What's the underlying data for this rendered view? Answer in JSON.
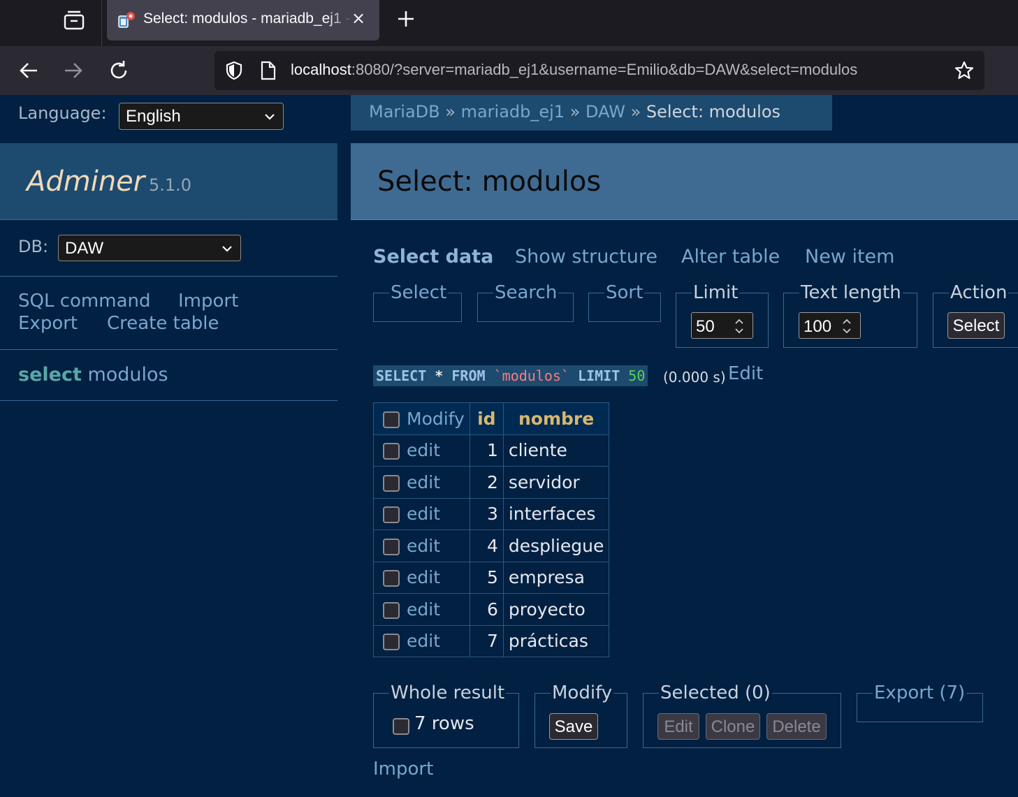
{
  "browser": {
    "tab_title": "Select: modulos - mariadb_ej1 - Adminer",
    "tab_close": "×",
    "url_host": "localhost",
    "url_rest": ":8080/?server=mariadb_ej1&username=Emilio&db=DAW&select=modulos",
    "icons": [
      "tab-overview-icon",
      "adminer-favicon-icon",
      "close-icon",
      "plus-icon",
      "back-arrow-icon",
      "forward-arrow-icon",
      "reload-icon",
      "shield-icon",
      "page-icon",
      "star-icon"
    ]
  },
  "language": {
    "label": "Language:",
    "value": "English"
  },
  "breadcrumb": {
    "items": [
      "MariaDB",
      "mariadb_ej1",
      "DAW"
    ],
    "separator": "»",
    "current": "Select: modulos"
  },
  "sidebar": {
    "brand": "Adminer",
    "version": "5.1.0",
    "db_label": "DB:",
    "db_value": "DAW",
    "links": {
      "sql": "SQL command",
      "import": "Import",
      "export": "Export",
      "create": "Create table"
    },
    "table_select_kw": "select",
    "table_name": "modulos"
  },
  "main": {
    "title": "Select: modulos",
    "menu": {
      "select_data": "Select data",
      "show_structure": "Show structure",
      "alter_table": "Alter table",
      "new_item": "New item"
    },
    "form": {
      "select": "Select",
      "search": "Search",
      "sort": "Sort",
      "limit": "Limit",
      "limit_value": "50",
      "text_length": "Text length",
      "text_length_value": "100",
      "action": "Action",
      "action_button": "Select"
    },
    "query": {
      "select": "SELECT",
      "star": "*",
      "from": "FROM",
      "table": "`modulos`",
      "limit": "LIMIT",
      "limit_value": "50",
      "timing": "(0.000 s)",
      "edit": "Edit"
    },
    "table": {
      "headers": {
        "modify": "Modify",
        "id": "id",
        "nombre": "nombre"
      },
      "edit_label": "edit",
      "rows": [
        {
          "id": "1",
          "nombre": "cliente"
        },
        {
          "id": "2",
          "nombre": "servidor"
        },
        {
          "id": "3",
          "nombre": "interfaces"
        },
        {
          "id": "4",
          "nombre": "despliegue"
        },
        {
          "id": "5",
          "nombre": "empresa"
        },
        {
          "id": "6",
          "nombre": "proyecto"
        },
        {
          "id": "7",
          "nombre": "prácticas"
        }
      ]
    },
    "bottom": {
      "whole_result": "Whole result",
      "rows": "7 rows",
      "modify": "Modify",
      "save": "Save",
      "selected": "Selected (0)",
      "edit": "Edit",
      "clone": "Clone",
      "delete": "Delete",
      "export": "Export (7)",
      "import": "Import"
    }
  },
  "colors": {
    "page_bg": "#012042",
    "header_bg": "#1d4a6f",
    "title_bg": "#3f6b93",
    "link": "#7aa6cc",
    "brand": "#f2d9b8"
  }
}
